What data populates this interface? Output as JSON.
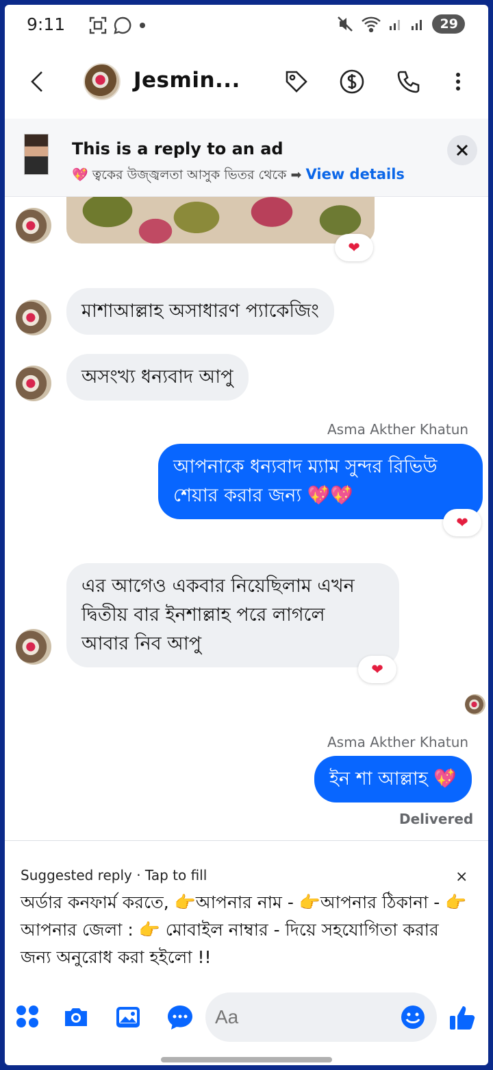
{
  "status_bar": {
    "time": "9:11",
    "battery": "29"
  },
  "header": {
    "contact_name": "Jesmin..."
  },
  "ad_banner": {
    "title": "This is a reply to an ad",
    "subtitle": "💖 ত্বকের উজ্জ্বলতা আসুক ভিতর থেকে ➡",
    "link": "View details"
  },
  "messages": [
    {
      "text": "মাশাআল্লাহ অসাধারণ প্যাকেজিং"
    },
    {
      "text": "অসংখ্য ধন্যবাদ আপু"
    },
    {
      "sender": "Asma Akther Khatun",
      "line1": "আপনাকে ধন্যবাদ ম্যাম সুন্দর রিভিউ",
      "line2": "শেয়ার করার জন্য 💖💖"
    },
    {
      "line1": "এর আগেও একবার নিয়েছিলাম এখন",
      "line2": "দ্বিতীয় বার ইনশাল্লাহ পরে লাগলে",
      "line3": "আবার নিব আপু"
    },
    {
      "sender": "Asma Akther Khatun",
      "text": "ইন শা আল্লাহ 💖"
    }
  ],
  "reaction": "❤",
  "status": "Delivered",
  "suggested_reply": {
    "label": "Suggested reply · Tap to fill",
    "close": "×",
    "text": "অর্ডার কনফার্ম করতে, 👉আপনার নাম - 👉আপনার ঠিকানা - 👉আপনার জেলা : 👉 মোবাইল নাম্বার - দিয়ে সহযোগিতা করার জন্য অনুরোধ করা হইলো !!"
  },
  "composer": {
    "placeholder": "Aa"
  },
  "colors": {
    "accent": "#0866ff",
    "incoming_bubble": "#eef0f3",
    "heart": "#e41e3f",
    "link": "#0a66e8"
  }
}
